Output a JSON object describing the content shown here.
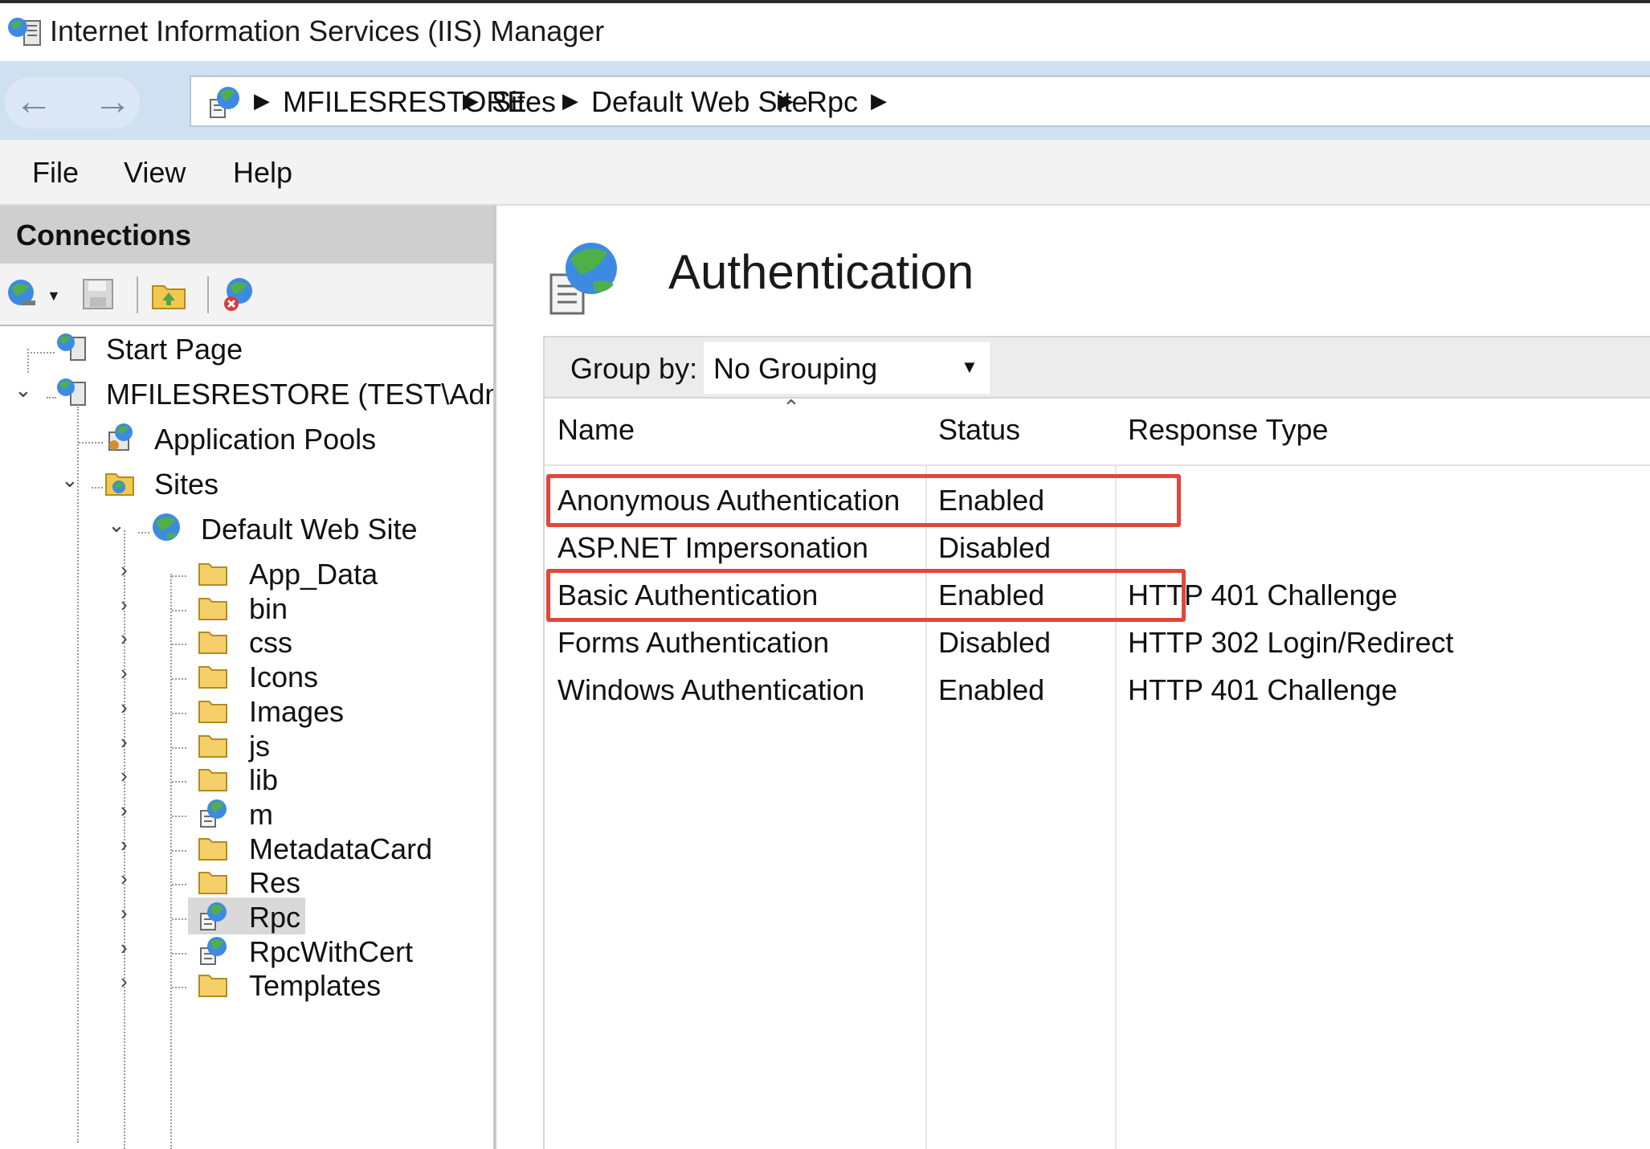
{
  "window": {
    "title": "Internet Information Services (IIS) Manager"
  },
  "address_bar": {
    "crumbs": [
      "MFILESRESTORE",
      "Sites",
      "Default Web Site",
      "Rpc"
    ]
  },
  "menu": {
    "items": [
      "File",
      "View",
      "Help"
    ]
  },
  "connections": {
    "title": "Connections",
    "toolbar_icons": [
      "connect-icon",
      "save-icon",
      "up-folder-icon",
      "disconnect-icon"
    ],
    "tree": {
      "start_page": "Start Page",
      "server": "MFILESRESTORE (TEST\\Admin",
      "app_pools": "Application Pools",
      "sites": "Sites",
      "default_site": "Default Web Site",
      "children": [
        {
          "label": "App_Data",
          "icon": "folder-icon"
        },
        {
          "label": "bin",
          "icon": "folder-icon"
        },
        {
          "label": "css",
          "icon": "folder-icon"
        },
        {
          "label": "Icons",
          "icon": "folder-icon"
        },
        {
          "label": "Images",
          "icon": "folder-icon"
        },
        {
          "label": "js",
          "icon": "folder-icon"
        },
        {
          "label": "lib",
          "icon": "folder-icon"
        },
        {
          "label": "m",
          "icon": "web-app-icon"
        },
        {
          "label": "MetadataCard",
          "icon": "folder-icon"
        },
        {
          "label": "Res",
          "icon": "folder-icon"
        },
        {
          "label": "Rpc",
          "icon": "web-app-icon",
          "selected": true
        },
        {
          "label": "RpcWithCert",
          "icon": "web-app-icon"
        },
        {
          "label": "Templates",
          "icon": "folder-icon"
        }
      ]
    }
  },
  "feature": {
    "title": "Authentication",
    "group_by_label": "Group by:",
    "group_by_value": "No Grouping",
    "columns": [
      "Name",
      "Status",
      "Response Type"
    ],
    "rows": [
      {
        "name": "Anonymous Authentication",
        "status": "Enabled",
        "response": "",
        "highlighted": true
      },
      {
        "name": "ASP.NET Impersonation",
        "status": "Disabled",
        "response": ""
      },
      {
        "name": "Basic Authentication",
        "status": "Enabled",
        "response": "HTTP 401 Challenge",
        "highlighted": true
      },
      {
        "name": "Forms Authentication",
        "status": "Disabled",
        "response": "HTTP 302 Login/Redirect"
      },
      {
        "name": "Windows Authentication",
        "status": "Enabled",
        "response": "HTTP 401 Challenge"
      }
    ]
  },
  "colors": {
    "highlight_border": "#e0473c",
    "address_bar_bg": "#cfe0f1"
  }
}
